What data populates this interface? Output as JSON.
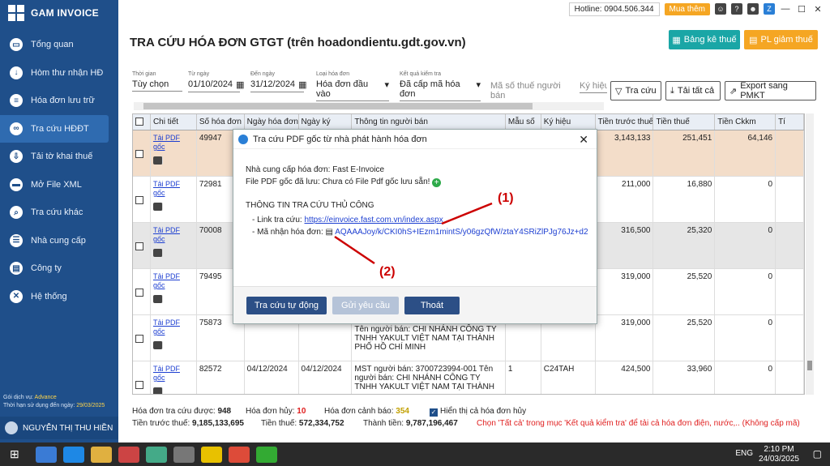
{
  "app": {
    "brand": "GAM INVOICE"
  },
  "sidebar": {
    "items": [
      {
        "label": "Tổng quan",
        "icon": "monitor-icon"
      },
      {
        "label": "Hòm thư nhận HĐ",
        "icon": "inbox-icon"
      },
      {
        "label": "Hóa đơn lưu trữ",
        "icon": "document-icon"
      },
      {
        "label": "Tra cứu HĐĐT",
        "icon": "link-icon"
      },
      {
        "label": "Tải tờ khai thuế",
        "icon": "download-icon"
      },
      {
        "label": "Mở File XML",
        "icon": "folder-icon"
      },
      {
        "label": "Tra cứu khác",
        "icon": "search-icon"
      },
      {
        "label": "Nhà cung cấp",
        "icon": "list-icon"
      },
      {
        "label": "Công ty",
        "icon": "building-icon"
      },
      {
        "label": "Hệ thống",
        "icon": "tools-icon"
      }
    ],
    "service_label": "Gói dịch vụ:",
    "service_value": "Advance",
    "expiry_label": "Thời hạn sử dụng đến ngày:",
    "expiry_value": "29/03/2025",
    "user": "NGUYỄN THỊ THU HIỀN"
  },
  "topbar": {
    "hotline": "Hotline: 0904.506.344",
    "buy": "Mua thêm"
  },
  "page": {
    "title": "TRA CỨU HÓA ĐƠN GTGT (trên hoadondientu.gdt.gov.vn)",
    "btn_bang_ke": "Bảng kê thuế",
    "btn_pl": "PL giảm thuế"
  },
  "filters": {
    "thoi_gian_label": "Thời gian",
    "thoi_gian": "Tùy chọn",
    "tu_ngay_label": "Từ ngày",
    "tu_ngay": "01/10/2024",
    "den_ngay_label": "Đến ngày",
    "den_ngay": "31/12/2024",
    "loai_label": "Loại hóa đơn",
    "loai": "Hóa đơn đầu vào",
    "kq_label": "Kết quả kiểm tra",
    "kq": "Đã cấp mã hóa đơn",
    "mst_placeholder": "Mã số thuế người bán",
    "ky_hieu_placeholder": "Ký hiệu"
  },
  "actions": {
    "tra_cuu": "Tra cứu",
    "tai_tat_ca": "Tải tất cả",
    "export": "Export sang PMKT"
  },
  "table": {
    "headers": [
      "Chi tiết",
      "Số hóa đơn",
      "Ngày hóa đơn",
      "Ngày ký",
      "Thông tin người bán",
      "Mẫu số",
      "Ký hiệu",
      "Tiền trước thuế",
      "Tiền thuế",
      "Tiền Ckkm",
      "Tí"
    ],
    "pdf_label": "Tải PDF gốc",
    "rows": [
      {
        "so": "49947",
        "ngay": "",
        "ky": "",
        "ban": "",
        "mau": "",
        "kh": "",
        "truoc": "3,143,133",
        "thue": "251,451",
        "ck": "64,146"
      },
      {
        "so": "72981",
        "ngay": "",
        "ky": "",
        "ban": "",
        "mau": "",
        "kh": "",
        "truoc": "211,000",
        "thue": "16,880",
        "ck": "0"
      },
      {
        "so": "70008",
        "ngay": "",
        "ky": "",
        "ban": "",
        "mau": "",
        "kh": "",
        "truoc": "316,500",
        "thue": "25,320",
        "ck": "0"
      },
      {
        "so": "79495",
        "ngay": "",
        "ky": "",
        "ban": "",
        "mau": "",
        "kh": "",
        "truoc": "319,000",
        "thue": "25,520",
        "ck": "0"
      },
      {
        "so": "75873",
        "ngay": "",
        "ky": "",
        "ban": "Tên người bán: CHI NHÁNH CÔNG TY TNHH YAKULT VIỆT NAM TẠI THÀNH PHỐ HỒ CHÍ MINH",
        "mau": "",
        "kh": "",
        "truoc": "319,000",
        "thue": "25,520",
        "ck": "0"
      },
      {
        "so": "82572",
        "ngay": "04/12/2024",
        "ky": "04/12/2024",
        "ban": "MST người bán: 3700723994-001 Tên người bán: CHI NHÁNH CÔNG TY TNHH YAKULT VIỆT NAM TẠI THÀNH",
        "mau": "1",
        "kh": "C24TAH",
        "truoc": "424,500",
        "thue": "33,960",
        "ck": "0"
      }
    ]
  },
  "stats": {
    "tra_cuu_label": "Hóa đơn tra cứu được:",
    "tra_cuu": "948",
    "huy_label": "Hóa đơn hủy:",
    "huy": "10",
    "canh_bao_label": "Hóa đơn cảnh báo:",
    "canh_bao": "354",
    "hien_thi": "Hiển thị cả hóa đơn hủy",
    "truoc_label": "Tiền trước thuế:",
    "truoc": "9,185,133,695",
    "thue_label": "Tiền thuế:",
    "thue": "572,334,752",
    "thanh_label": "Thành tiền:",
    "thanh": "9,787,196,467",
    "note": "Chọn 'Tất cả' trong mục 'Kết quả kiểm tra' để tải cả hóa đơn điện, nước,.. (Không cấp mã)"
  },
  "modal": {
    "title": "Tra cứu PDF gốc từ nhà phát hành hóa đơn",
    "ncc_label": "Nhà cung cấp hóa đơn:",
    "ncc": "Fast E-Invoice",
    "pdf_label": "File PDF gốc đã lưu:",
    "pdf": "Chưa có File Pdf gốc lưu sẵn!",
    "section": "THÔNG TIN TRA CỨU THỦ CÔNG",
    "link_label": "- Link tra cứu:",
    "link": "https://einvoice.fast.com.vn/index.aspx",
    "code_label": "- Mã nhận hóa đơn:",
    "code": "AQAAAJoy/k/CKI0hS+IEzm1mintS/y06gzQfW/ztaY4SRiZlPJg76Jz+d2",
    "btn_auto": "Tra cứu tự động",
    "btn_request": "Gửi yêu cầu",
    "btn_exit": "Thoát",
    "ann1": "(1)",
    "ann2": "(2)"
  },
  "taskbar": {
    "lang": "ENG",
    "time": "2:10 PM",
    "date": "24/03/2025"
  }
}
